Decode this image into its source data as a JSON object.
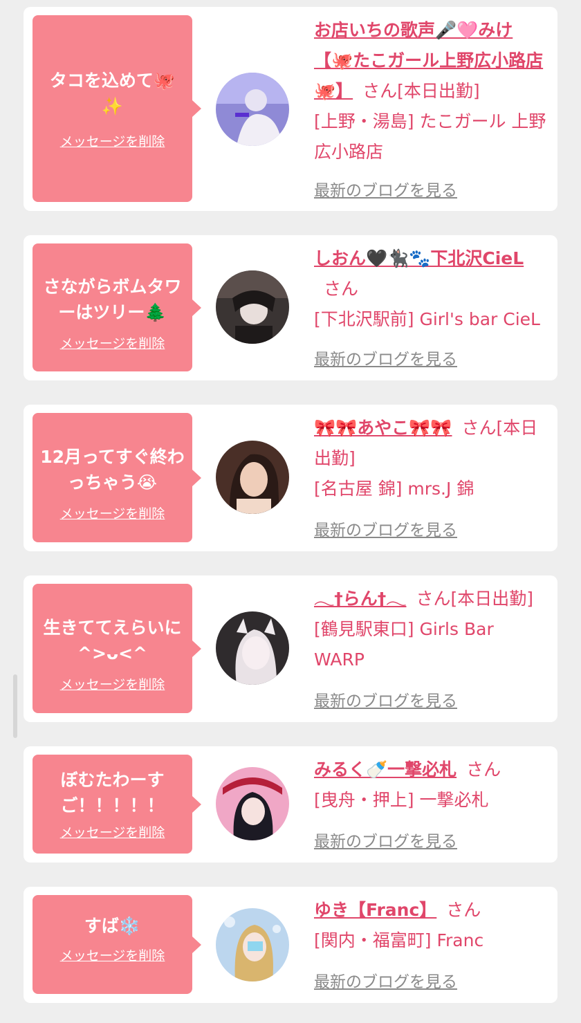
{
  "delete_label": "メッセージを削除",
  "blog_label": "最新のブログを見る",
  "san_label": "さん",
  "colors": {
    "bubble": "#f7858f",
    "accent": "#e0466a",
    "card": "#ffffff",
    "page": "#eeeeee",
    "blog": "#8a8a8a"
  },
  "items": [
    {
      "message": "タコを込めて🐙✨",
      "name": "お店いちの歌声🎤🩷みけ【🐙たこガール上野広小路店🐙】",
      "status": "[本日出勤]",
      "shop": "[上野・湯島] たこガール 上野広小路店"
    },
    {
      "message": "さながらボムタワーはツリー🌲",
      "name": "しおん🖤🐈‍⬛🐾下北沢CieL",
      "status": "",
      "shop": "[下北沢駅前] Girl's bar CieL"
    },
    {
      "message": "12月ってすぐ終わっちゃう😭",
      "name": "🎀🎀あやこ🎀🎀",
      "status": "[本日出勤]",
      "shop": "[名古屋 錦] mrs.J 錦"
    },
    {
      "message": "生きててえらいに^>ᴗ<^",
      "name": "𓂃†らん†𓂃",
      "status": "[本日出勤]",
      "shop": "[鶴見駅東口] Girls Bar WARP"
    },
    {
      "message": "ぼむたわーすご！！！！！",
      "name": "みるく🍼一撃必札",
      "status": "",
      "shop": "[曳舟・押上] 一撃必札"
    },
    {
      "message": "すば❄️",
      "name": "ゆき【Franc】",
      "status": "",
      "shop": "[関内・福富町] Franc"
    }
  ]
}
